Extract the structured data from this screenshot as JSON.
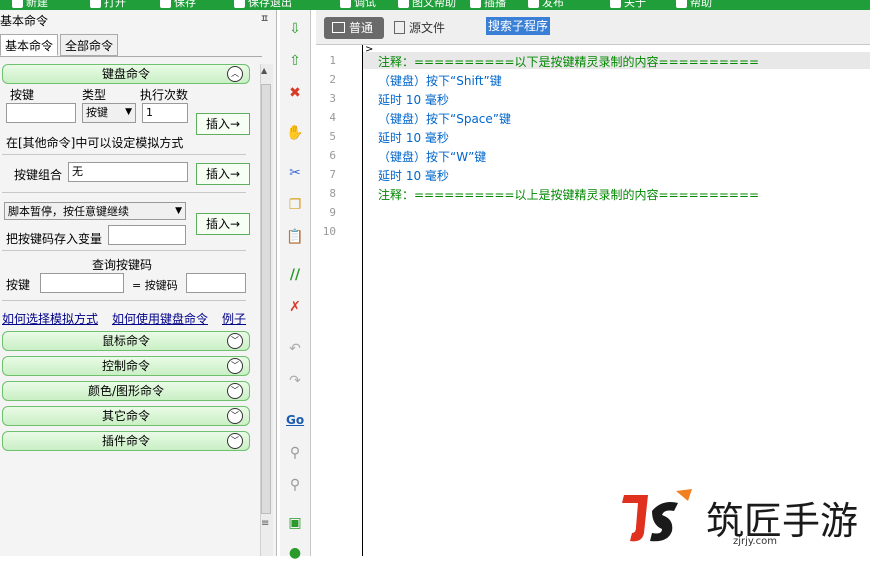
{
  "toolbar": {
    "items": [
      "新建",
      "打开",
      "保存",
      "保存退出",
      "调试",
      "图文帮助",
      "插播",
      "发布",
      "关于",
      "帮助"
    ]
  },
  "panel": {
    "title": "基本命令",
    "pin": "ㅍ",
    "tabs": [
      {
        "label": "基本命令",
        "active": true
      },
      {
        "label": "全部命令",
        "active": false
      }
    ]
  },
  "keyboard": {
    "group_label": "键盘命令",
    "key_label": "按键",
    "type_label": "类型",
    "times_label": "执行次数",
    "type_value": "按键",
    "times_value": "1",
    "hint": "在[其他命令]中可以设定模拟方式",
    "insert_label": "插入→",
    "combo_label": "按键组合",
    "combo_value": "无",
    "pause_select": "脚本暂停，按任意键继续",
    "save_var_label": "把按键码存入变量",
    "query_title": "查询按键码",
    "query_key_label": "按键",
    "query_code_label": "= 按键码",
    "links": [
      "如何选择模拟方式",
      "如何使用键盘命令",
      "例子"
    ]
  },
  "groups": [
    "鼠标命令",
    "控制命令",
    "颜色/图形命令",
    "其它命令",
    "插件命令"
  ],
  "editor": {
    "modes": [
      {
        "label": "普通",
        "active": true
      },
      {
        "label": "源文件",
        "active": false
      }
    ],
    "search_sub": "搜索子程序",
    "lines": [
      {
        "num": "1",
        "text": "注释：==========以下是按键精灵录制的内容==========",
        "kind": "comment"
      },
      {
        "num": "2",
        "text": "（键盘）按下“Shift”键",
        "kind": "cmd"
      },
      {
        "num": "3",
        "text": "延时 10 毫秒",
        "kind": "cmd"
      },
      {
        "num": "4",
        "text": "（键盘）按下“Space”键",
        "kind": "cmd"
      },
      {
        "num": "5",
        "text": "延时 10 毫秒",
        "kind": "cmd"
      },
      {
        "num": "6",
        "text": "（键盘）按下“W”键",
        "kind": "cmd"
      },
      {
        "num": "7",
        "text": "延时 10 毫秒",
        "kind": "cmd"
      },
      {
        "num": "8",
        "text": "注释：==========以上是按键精灵录制的内容==========",
        "kind": "comment"
      },
      {
        "num": "9",
        "text": "",
        "kind": "cmd"
      },
      {
        "num": "10",
        "text": "",
        "kind": "cmd"
      }
    ]
  },
  "vtoolbar": {
    "icons": [
      "arrow-down-icon",
      "arrow-up-icon",
      "delete-icon",
      "hand-icon",
      "cut-icon",
      "copy-icon",
      "paste-icon",
      "comment-icon",
      "uncomment-icon",
      "undo-icon",
      "redo-icon",
      "go-icon",
      "find-icon",
      "find-next-icon",
      "panel-icon",
      "globe-icon"
    ],
    "go_label": "Go"
  },
  "watermark": {
    "brand": "筑匠手游",
    "domain": "zjrjy.com"
  },
  "colors": {
    "toolbar": "#1f9e3a",
    "group_border": "#6fc06f",
    "comment": "#008800",
    "command": "#0066cc",
    "selection": "#3a7fd6"
  }
}
